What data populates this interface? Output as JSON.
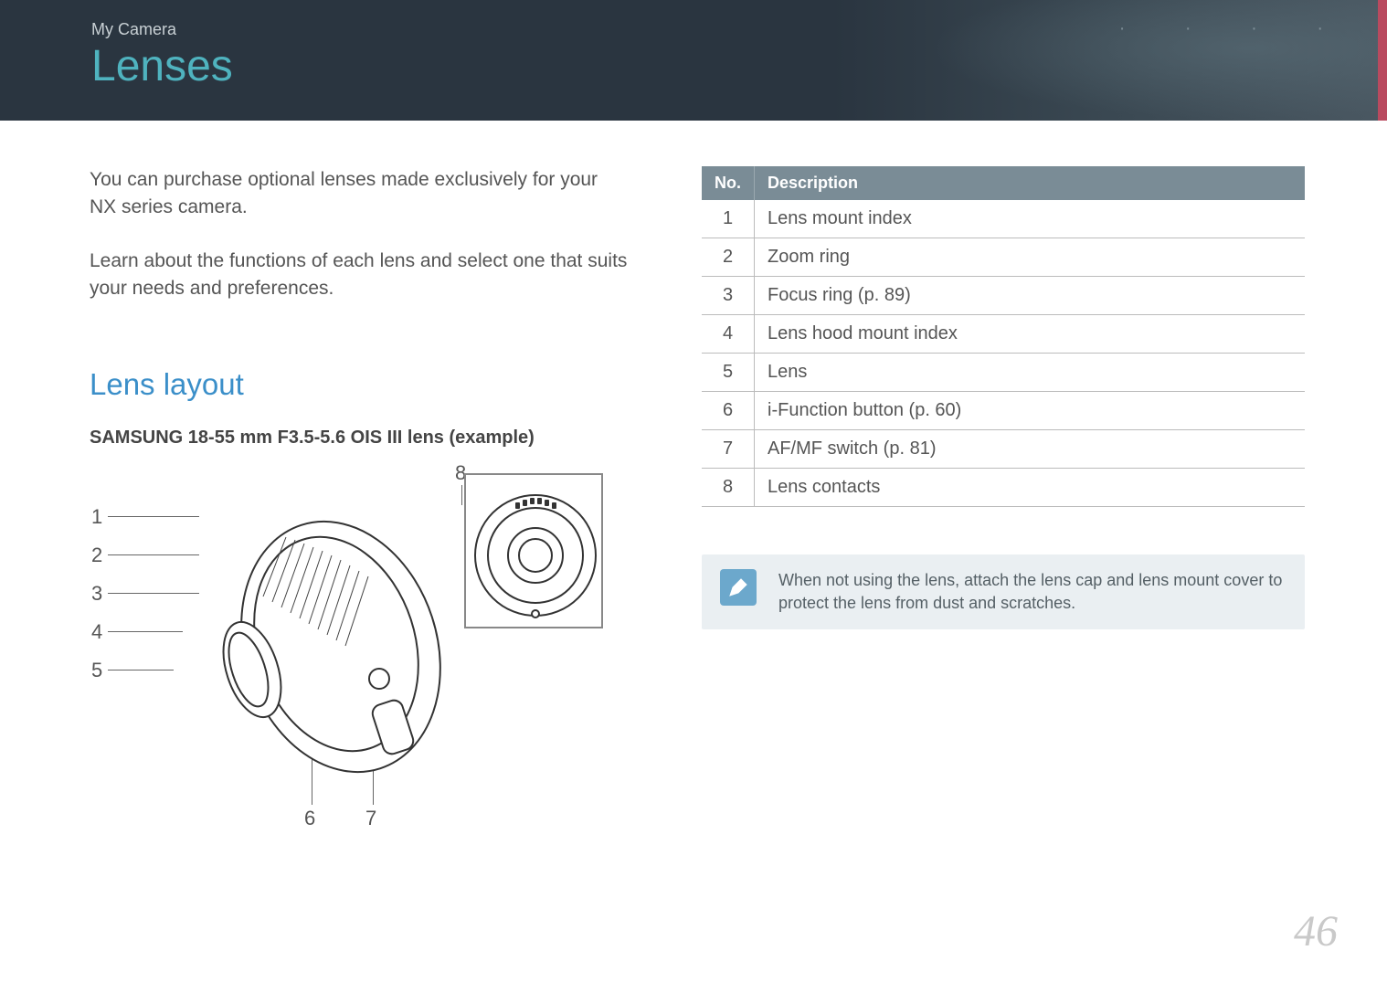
{
  "header": {
    "breadcrumb": "My Camera",
    "title": "Lenses"
  },
  "intro": {
    "p1": "You can purchase optional lenses made exclusively for your NX series camera.",
    "p2": "Learn about the functions of each lens and select one that suits your needs and preferences."
  },
  "section": {
    "heading": "Lens layout",
    "example_label": "SAMSUNG 18-55 mm F3.5-5.6 OIS III lens (example)"
  },
  "diagram": {
    "callouts": [
      "1",
      "2",
      "3",
      "4",
      "5",
      "6",
      "7",
      "8"
    ]
  },
  "table": {
    "head_no": "No.",
    "head_desc": "Description",
    "rows": [
      {
        "no": "1",
        "desc": "Lens mount index"
      },
      {
        "no": "2",
        "desc": "Zoom ring"
      },
      {
        "no": "3",
        "desc": "Focus ring (p. 89)"
      },
      {
        "no": "4",
        "desc": "Lens hood mount index"
      },
      {
        "no": "5",
        "desc": "Lens"
      },
      {
        "no": "6",
        "desc": "i-Function button (p. 60)"
      },
      {
        "no": "7",
        "desc": "AF/MF switch (p. 81)"
      },
      {
        "no": "8",
        "desc": "Lens contacts"
      }
    ]
  },
  "note": {
    "text": "When not using the lens, attach the lens cap and lens mount cover to protect the lens from dust and scratches."
  },
  "page_number": "46"
}
